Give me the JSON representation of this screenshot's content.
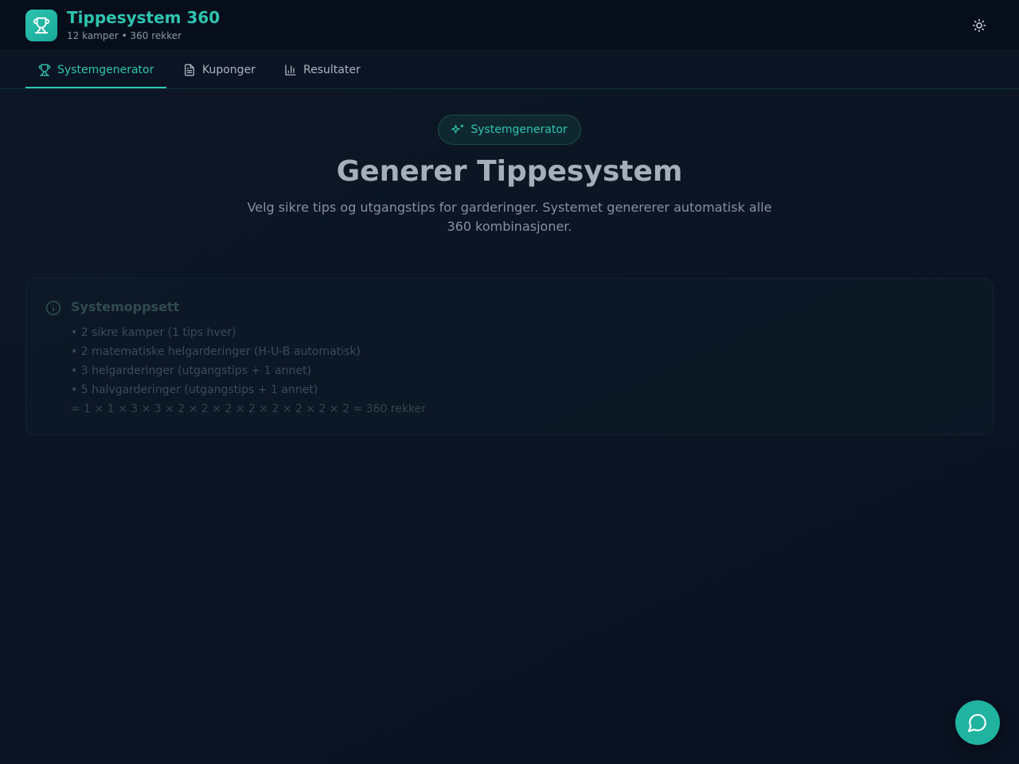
{
  "header": {
    "title": "Tippesystem 360",
    "subtitle": "12 kamper • 360 rekker",
    "logo_icon": "trophy-icon",
    "theme_toggle_icon": "sun-icon"
  },
  "tabs": [
    {
      "label": "Systemgenerator",
      "icon": "trophy-icon",
      "active": true
    },
    {
      "label": "Kuponger",
      "icon": "document-icon",
      "active": false
    },
    {
      "label": "Resultater",
      "icon": "bar-chart-icon",
      "active": false
    }
  ],
  "hero": {
    "badge": "Systemgenerator",
    "badge_icon": "sparkles-icon",
    "title": "Generer Tippesystem",
    "description": "Velg sikre tips og utgangstips for garderinger. Systemet genererer automatisk alle 360 kombinasjoner."
  },
  "info": {
    "title": "Systemoppsett",
    "icon": "info-icon",
    "items": [
      "• 2 sikre kamper (1 tips hver)",
      "• 2 matematiske helgarderinger (H-U-B automatisk)",
      "• 3 helgarderinger (utgangstips + 1 annet)",
      "• 5 halvgarderinger (utgangstips + 1 annet)"
    ],
    "formula": "= 1 × 1 × 3 × 3 × 2 × 2 × 2 × 2 × 2 × 2 × 2 × 2 = 360 rekker"
  },
  "chat": {
    "icon": "chat-bubble-icon"
  },
  "colors": {
    "accent": "#2ec4b0",
    "background": "#0b1524",
    "header_bg": "#060e1b"
  }
}
